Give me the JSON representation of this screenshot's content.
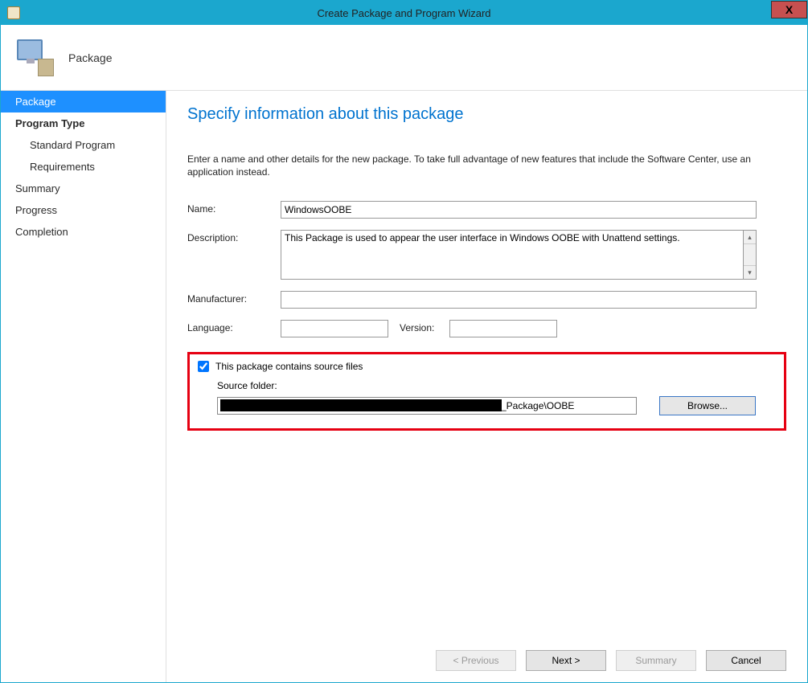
{
  "window": {
    "title": "Create Package and Program Wizard",
    "close_symbol": "X"
  },
  "banner": {
    "heading": "Package"
  },
  "sidebar": {
    "items": [
      {
        "label": "Package",
        "active": true
      },
      {
        "label": "Program Type",
        "bold": true
      },
      {
        "label": "Standard Program",
        "sub": true
      },
      {
        "label": "Requirements",
        "sub": true
      },
      {
        "label": "Summary"
      },
      {
        "label": "Progress"
      },
      {
        "label": "Completion"
      }
    ]
  },
  "main": {
    "heading": "Specify information about this package",
    "instruction": "Enter a name and other details for the new package. To take full advantage of new features that include the Software Center, use an application instead.",
    "labels": {
      "name": "Name:",
      "description": "Description:",
      "manufacturer": "Manufacturer:",
      "language": "Language:",
      "version": "Version:"
    },
    "values": {
      "name": "WindowsOOBE",
      "description": "This Package is used to appear the user interface in Windows OOBE with Unattend settings.",
      "manufacturer": "",
      "language": "",
      "version": ""
    },
    "source": {
      "checkbox_label": "This package contains source files",
      "checked": true,
      "folder_label": "Source folder:",
      "folder_value_visible_suffix": "_Package\\OOBE",
      "browse_label": "Browse..."
    }
  },
  "footer": {
    "previous": "< Previous",
    "next": "Next >",
    "summary": "Summary",
    "cancel": "Cancel"
  }
}
